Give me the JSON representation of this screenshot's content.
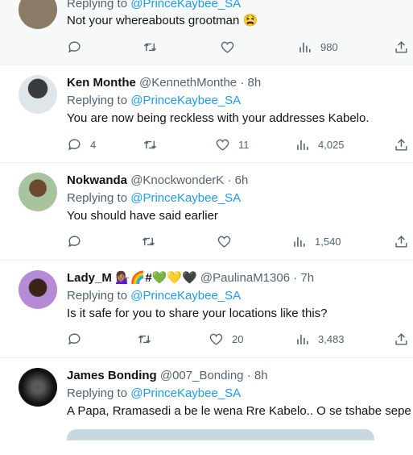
{
  "tweets": [
    {
      "name": "",
      "handle": "",
      "time": "",
      "replying_prefix": "Replying to",
      "replying_to": "@PrinceKaybee_SA",
      "text": "Not your whereabouts grootman 😫",
      "replies": "",
      "retweets": "",
      "likes": "",
      "views": "980"
    },
    {
      "name": "Ken Monthe",
      "handle": "@KennethMonthe",
      "time": "· 8h",
      "replying_prefix": "Replying to",
      "replying_to": "@PrinceKaybee_SA",
      "text": "You are now being reckless with your addresses Kabelo.",
      "replies": "4",
      "retweets": "",
      "likes": "11",
      "views": "4,025"
    },
    {
      "name": "Nokwanda",
      "handle": "@KnockwonderK",
      "time": "· 6h",
      "replying_prefix": "Replying to",
      "replying_to": "@PrinceKaybee_SA",
      "text": "You should have said earlier",
      "replies": "",
      "retweets": "",
      "likes": "",
      "views": "1,540"
    },
    {
      "name": "Lady_M 💁🏽‍♀️🌈#💚💛🖤",
      "handle": "@PaulinaM1306",
      "time": "· 7h",
      "replying_prefix": "Replying to",
      "replying_to": "@PrinceKaybee_SA",
      "text": "Is it safe for you to share your locations like this?",
      "replies": "",
      "retweets": "",
      "likes": "20",
      "views": "3,483"
    },
    {
      "name": "James Bonding",
      "handle": "@007_Bonding",
      "time": "· 8h",
      "replying_prefix": "Replying to",
      "replying_to": "@PrinceKaybee_SA",
      "text": "A Papa, Rramasedi a be le wena Rre Kabelo.. O se tshabe sepe"
    }
  ],
  "colors": {
    "link": "#1d9bf0",
    "muted": "#536471",
    "text": "#0f1419",
    "highlight_bg": "#f7f9f9"
  }
}
